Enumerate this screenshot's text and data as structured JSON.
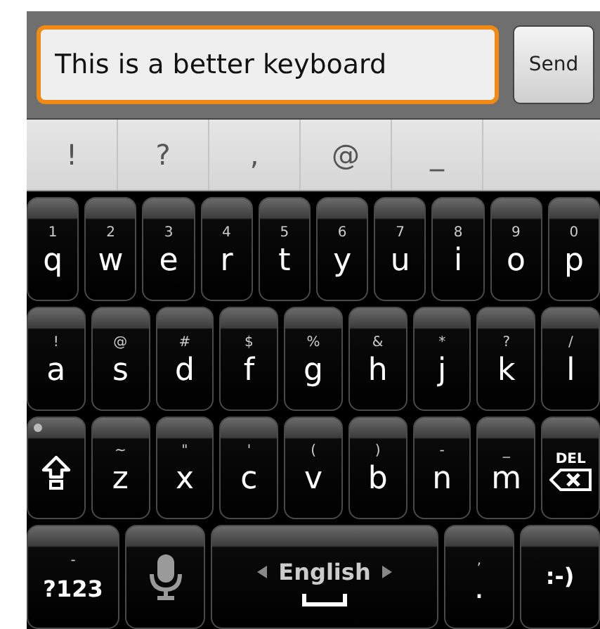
{
  "input": {
    "value": "This is a better keyboard",
    "focused": true
  },
  "send_button": {
    "label": "Send"
  },
  "suggestions": [
    "!",
    "?",
    ",",
    "@",
    "_"
  ],
  "rows": [
    [
      {
        "kind": "letter",
        "label": "q",
        "hint": "1"
      },
      {
        "kind": "letter",
        "label": "w",
        "hint": "2"
      },
      {
        "kind": "letter",
        "label": "e",
        "hint": "3"
      },
      {
        "kind": "letter",
        "label": "r",
        "hint": "4"
      },
      {
        "kind": "letter",
        "label": "t",
        "hint": "5"
      },
      {
        "kind": "letter",
        "label": "y",
        "hint": "6"
      },
      {
        "kind": "letter",
        "label": "u",
        "hint": "7"
      },
      {
        "kind": "letter",
        "label": "i",
        "hint": "8"
      },
      {
        "kind": "letter",
        "label": "o",
        "hint": "9"
      },
      {
        "kind": "letter",
        "label": "p",
        "hint": "0"
      }
    ],
    [
      {
        "kind": "letter",
        "label": "a",
        "hint": "!"
      },
      {
        "kind": "letter",
        "label": "s",
        "hint": "@"
      },
      {
        "kind": "letter",
        "label": "d",
        "hint": "#"
      },
      {
        "kind": "letter",
        "label": "f",
        "hint": "$"
      },
      {
        "kind": "letter",
        "label": "g",
        "hint": "%"
      },
      {
        "kind": "letter",
        "label": "h",
        "hint": "&"
      },
      {
        "kind": "letter",
        "label": "j",
        "hint": "*"
      },
      {
        "kind": "letter",
        "label": "k",
        "hint": "?"
      },
      {
        "kind": "letter",
        "label": "l",
        "hint": "/"
      }
    ],
    [
      {
        "kind": "shift",
        "on": false
      },
      {
        "kind": "letter",
        "label": "z",
        "hint": "~"
      },
      {
        "kind": "letter",
        "label": "x",
        "hint": "\""
      },
      {
        "kind": "letter",
        "label": "c",
        "hint": "'"
      },
      {
        "kind": "letter",
        "label": "v",
        "hint": "("
      },
      {
        "kind": "letter",
        "label": "b",
        "hint": ")"
      },
      {
        "kind": "letter",
        "label": "n",
        "hint": "-"
      },
      {
        "kind": "letter",
        "label": "m",
        "hint": "_"
      },
      {
        "kind": "delete",
        "label": "DEL"
      }
    ],
    [
      {
        "kind": "symbols",
        "label": "?123",
        "hint": "-"
      },
      {
        "kind": "mic"
      },
      {
        "kind": "space",
        "label": "English"
      },
      {
        "kind": "letter",
        "label": ".",
        "hint": ","
      },
      {
        "kind": "emoji",
        "label": ":-)"
      }
    ]
  ]
}
